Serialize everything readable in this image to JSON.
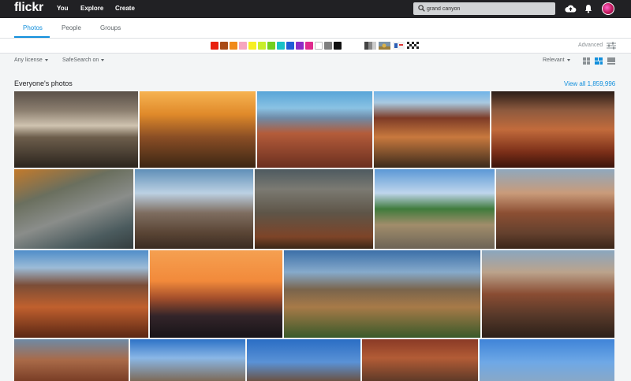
{
  "topnav": {
    "logo": "flickr",
    "links": [
      "You",
      "Explore",
      "Create"
    ],
    "search_value": "grand canyon"
  },
  "subnav": {
    "tabs": [
      "Photos",
      "People",
      "Groups"
    ],
    "active_tab": "Photos"
  },
  "colors": {
    "swatches": [
      "#e8200f",
      "#a94b16",
      "#f08a1a",
      "#f6a6bf",
      "#f7ef22",
      "#c8ee2b",
      "#72cf1f",
      "#17c1c6",
      "#1f5cd6",
      "#8e2cc7",
      "#e02b8e",
      "#ffffff",
      "#7f7f7f",
      "#111111"
    ],
    "patterns": [
      "black-and-white",
      "shallow-depth-of-field",
      "minimalist",
      "patterns"
    ],
    "advanced_label": "Advanced",
    "accent": "#128fdc"
  },
  "filters": {
    "license": "Any license",
    "safesearch": "SafeSearch on",
    "sort": "Relevant"
  },
  "section": {
    "title": "Everyone's photos",
    "view_all": "View all 1,859,996"
  },
  "photos": [
    {
      "row": 1,
      "gradient": "linear-gradient(180deg,#5a5048 0%,#8b7e6f 25%,#cfc3b0 45%,#6d5e4c 60%,#2b241d 100%)"
    },
    {
      "row": 1,
      "gradient": "linear-gradient(180deg,#f6b352 0%,#e08a2a 30%,#8a4e25 60%,#3c2614 100%)"
    },
    {
      "row": 1,
      "gradient": "linear-gradient(180deg,#58a5d8 0%,#8ac2e3 22%,#6f8aa6 35%,#b45c3a 55%,#6b2f20 100%)"
    },
    {
      "row": 1,
      "gradient": "linear-gradient(180deg,#6fb3e8 0%,#a9c9e0 15%,#7d3b26 35%,#c8793e 60%,#3b2a1c 100%)"
    },
    {
      "row": 1,
      "gradient": "linear-gradient(180deg,#2c1e18 0%,#8e5a3e 25%,#c26b3c 50%,#7a2e18 80%,#3a140b 100%)"
    },
    {
      "row": 2,
      "gradient": "linear-gradient(160deg,#c37a2b 0%,#6a6f5e 30%,#8a8d8a 55%,#4b5b5e 80%,#343d3e 100%)"
    },
    {
      "row": 2,
      "gradient": "linear-gradient(180deg,#5f8fb8 0%,#bcd1e3 30%,#7e6d60 55%,#5a4535 80%,#3a2c22 100%)"
    },
    {
      "row": 2,
      "gradient": "linear-gradient(180deg,#4e5a60 0%,#7b7a72 25%,#5e5548 55%,#7d4428 85%,#3a2617 100%)"
    },
    {
      "row": 2,
      "gradient": "linear-gradient(180deg,#5b98d6 0%,#bfd6ec 30%,#3f7b3c 50%,#a18d6b 70%,#6d6457 100%)"
    },
    {
      "row": 2,
      "gradient": "linear-gradient(180deg,#8fa8bd 0%,#c99b7a 30%,#8c4f33 55%,#65412e 80%,#3a2619 100%)"
    },
    {
      "row": 3,
      "gradient": "linear-gradient(180deg,#4f8dc9 0%,#9cbcd7 20%,#7b4d36 40%,#c0602e 65%,#5a2714 100%)"
    },
    {
      "row": 3,
      "gradient": "linear-gradient(180deg,#f5a051 0%,#f28a3b 35%,#a34e2b 55%,#33252a 75%,#181418 100%)"
    },
    {
      "row": 3,
      "gradient": "linear-gradient(180deg,#3b6fa8 0%,#86aacb 25%,#7a644c 45%,#a77a48 65%,#395a2a 100%)"
    },
    {
      "row": 3,
      "gradient": "linear-gradient(180deg,#8aa6bf 0%,#bba38c 25%,#8a4d33 50%,#563829 75%,#2c2019 100%)"
    },
    {
      "row": 4,
      "gradient": "linear-gradient(180deg,#6e8aa5 0%,#a96a48 50%,#7a3e26 100%)"
    },
    {
      "row": 4,
      "gradient": "linear-gradient(180deg,#2d72c6 0%,#8ab7e6 45%,#7d6a58 100%)"
    },
    {
      "row": 4,
      "gradient": "linear-gradient(180deg,#2a6dc4 0%,#5a92d6 55%,#6a5244 100%)"
    },
    {
      "row": 4,
      "gradient": "linear-gradient(180deg,#8a3a26 0%,#b25c36 45%,#5f3a28 100%)"
    },
    {
      "row": 4,
      "gradient": "linear-gradient(180deg,#3f84d8 0%,#6ea8e6 55%,#88a8c8 100%)"
    }
  ]
}
